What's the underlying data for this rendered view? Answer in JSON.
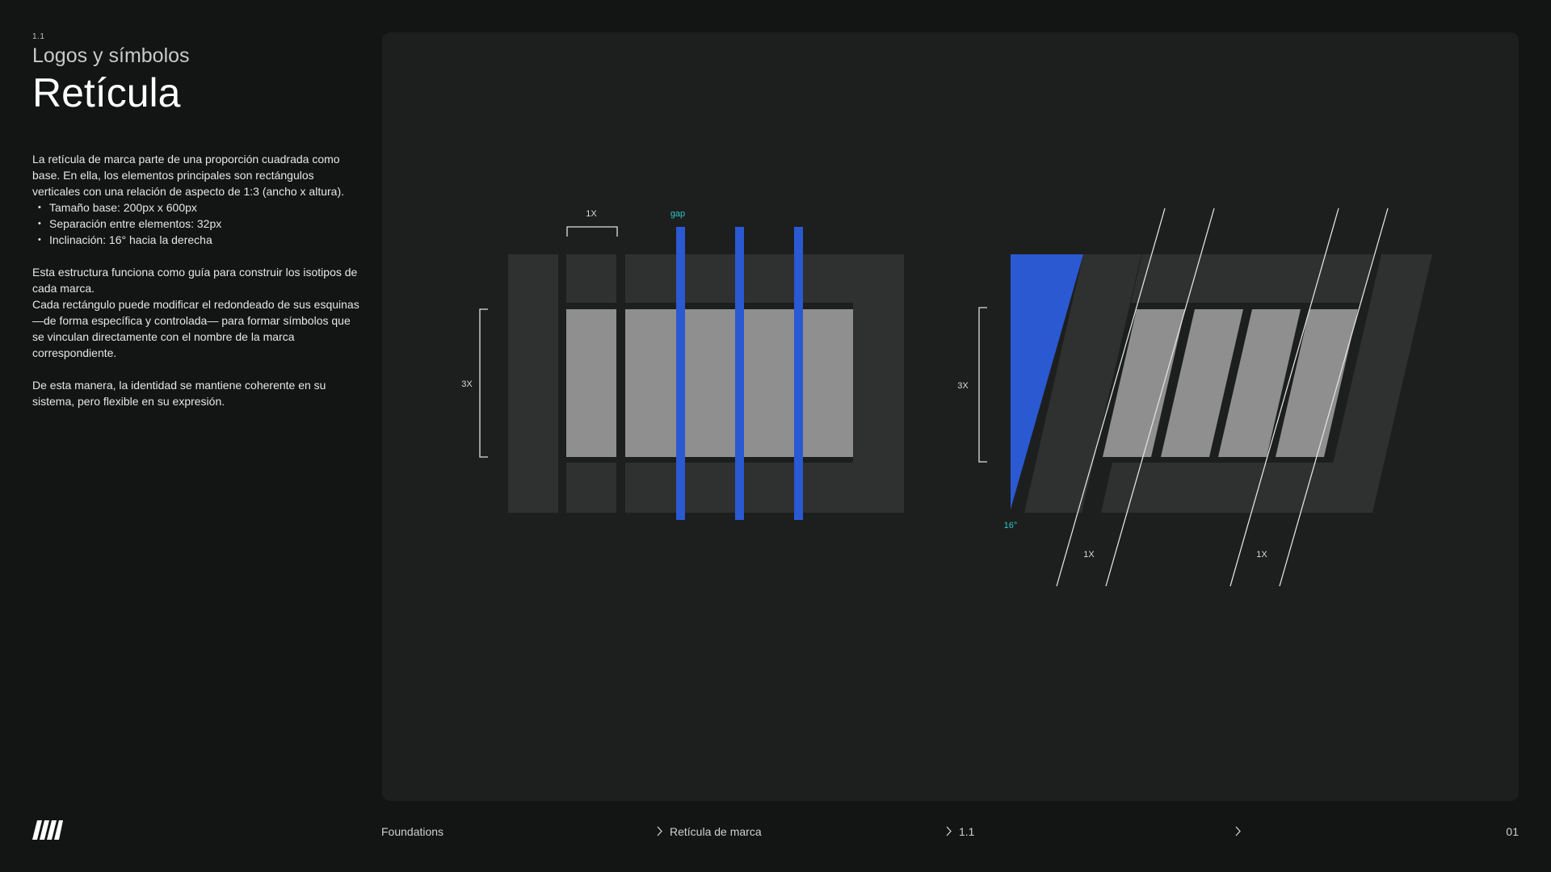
{
  "header": {
    "section_number": "1.1",
    "section_title": "Logos y símbolos",
    "page_title": "Retícula"
  },
  "description": {
    "intro": "La retícula de marca parte de una proporción cuadrada como base. En ella, los elementos principales son rectángulos verticales con una relación de aspecto de 1:3 (ancho x altura).",
    "bullets": [
      "Tamaño base: 200px x 600px",
      "Separación entre elementos: 32px",
      "Inclinación: 16° hacia la derecha"
    ],
    "para2": "Esta estructura funciona como guía para construir los isotipos de cada marca.",
    "para3": "Cada rectángulo puede modificar el redondeado de sus esquinas —de forma específica y controlada— para formar símbolos que se vinculan directamente con el nombre de la marca correspondiente.",
    "para4": "De esta manera, la identidad se mantiene coherente en su sistema, pero flexible en su expresión."
  },
  "diagram": {
    "label_1x": "1X",
    "label_gap": "gap",
    "label_3x": "3X",
    "label_angle": "16°",
    "colors": {
      "accent_blue": "#2a59d1",
      "accent_teal": "#2ec4c4",
      "dark_rect": "#2f3030",
      "light_rect": "#8f8f8f",
      "lines": "#e0e0e0"
    }
  },
  "footer": {
    "crumb1": "Foundations",
    "crumb2": "Retícula de marca",
    "crumb3": "1.1",
    "page_number": "01"
  }
}
